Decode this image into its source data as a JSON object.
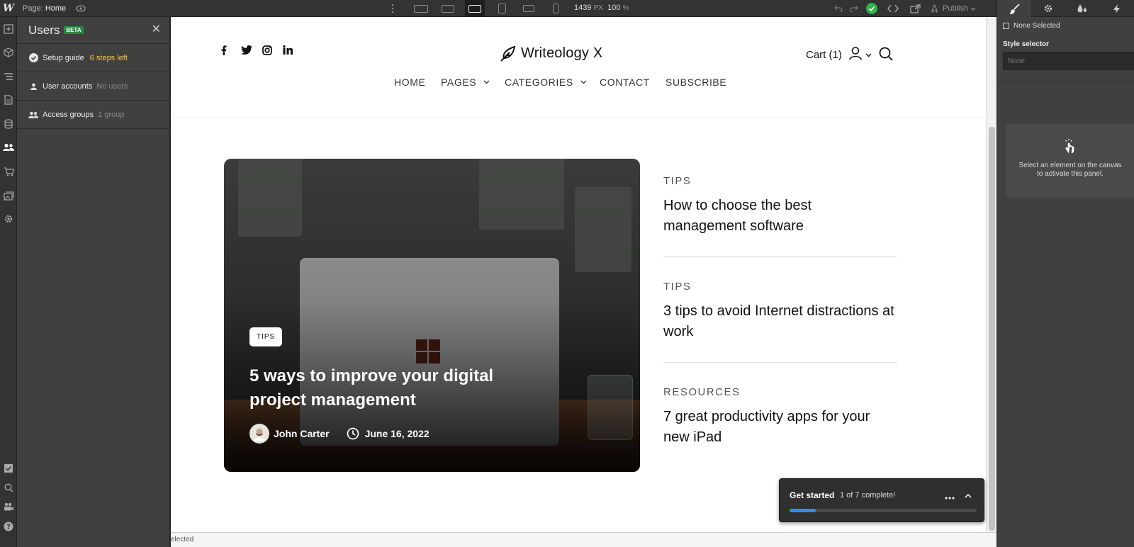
{
  "topbar": {
    "logo": "W",
    "page_prefix": "Page:",
    "page_name": "Home",
    "width_value": "1439",
    "width_unit": "PX",
    "zoom_value": "100",
    "zoom_unit": "%",
    "publish_label": "Publish"
  },
  "users_panel": {
    "title": "Users",
    "badge": "BETA",
    "rows": [
      {
        "label": "Setup guide",
        "note": "6 steps left"
      },
      {
        "label": "User accounts",
        "note": "No users"
      },
      {
        "label": "Access groups",
        "note": "1 group"
      }
    ]
  },
  "site": {
    "brand": "Writeology X",
    "cart": "Cart (1)",
    "nav": [
      "HOME",
      "PAGES",
      "CATEGORIES",
      "CONTACT",
      "SUBSCRIBE"
    ],
    "hero": {
      "tag": "TIPS",
      "title": "5 ways to improve your digital project management",
      "author": "John Carter",
      "date": "June 16, 2022"
    },
    "posts": [
      {
        "category": "TIPS",
        "title": "How to choose the best management software"
      },
      {
        "category": "TIPS",
        "title": "3 tips to avoid Internet distractions at work"
      },
      {
        "category": "RESOURCES",
        "title": "7 great productivity apps for your new iPad"
      }
    ]
  },
  "status_bar": "elected",
  "get_started": {
    "title": "Get started",
    "progress_text": "1 of 7 complete!",
    "progress_fraction": 0.14
  },
  "right_panel": {
    "selection": "None Selected",
    "style_selector_label": "Style selector",
    "style_selector_placeholder": "None",
    "hint": "Select an element on the canvas to activate this panel."
  },
  "colors": {
    "accent_blue": "#2f8cf0",
    "success_green": "#2fb34a",
    "warning_yellow": "#f5c542",
    "beta_green": "#2a8a3e"
  }
}
